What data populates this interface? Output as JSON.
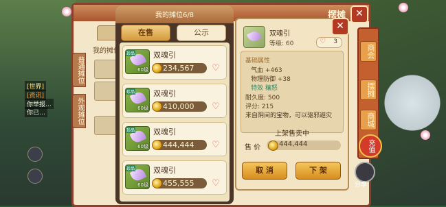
{
  "stall": {
    "title": "摆摊",
    "left_tabs": [
      "我要摆",
      "我要摆"
    ],
    "left_label": "我的摊位",
    "vtabs": [
      "普通摊位",
      "外观摊位"
    ]
  },
  "side_tabs": [
    "商会",
    "摆摊",
    "商城"
  ],
  "recharge_label": "充值",
  "share_label": "分享",
  "chat": {
    "lines": [
      "[世界]",
      "[资讯]",
      "你举报…",
      "你已…"
    ]
  },
  "list": {
    "title": "我的摊位6/8",
    "tabs": {
      "selling": "在售",
      "public": "公示"
    },
    "items": [
      {
        "name": "双魂引",
        "price": "234,567",
        "level": "60级",
        "tag": "珍品"
      },
      {
        "name": "双魂引",
        "price": "410,000",
        "level": "60级",
        "tag": "珍品"
      },
      {
        "name": "双魂引",
        "price": "444,444",
        "level": "60级",
        "tag": "珍品"
      },
      {
        "name": "双魂引",
        "price": "455,555",
        "level": "60级",
        "tag": "珍品"
      }
    ]
  },
  "detail": {
    "name": "双魂引",
    "level": "等级: 60",
    "fav_count": "3",
    "section_title": "基础属性",
    "stat1": "气血 +463",
    "stat2": "物理防御 +38",
    "effect": "特效  穰怒",
    "durability": "耐久度: 500",
    "score": "评分: 215",
    "desc": "来自阴间的宝物，可以驱邪避灾",
    "selling_title": "上架售卖中",
    "price_label": "售  价",
    "price": "444,444",
    "cancel": "取 消",
    "unlist": "下 架"
  }
}
